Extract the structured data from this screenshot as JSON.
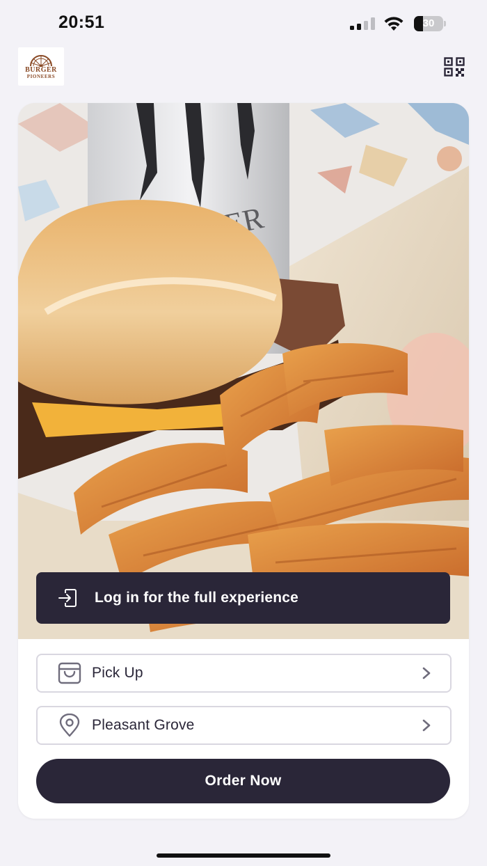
{
  "status_bar": {
    "time": "20:51",
    "battery_level": "30",
    "battery_fraction": 0.3,
    "icons": [
      "signal-icon",
      "wifi-icon",
      "battery-icon"
    ]
  },
  "header": {
    "logo": {
      "line1": "BURGER",
      "line2": "PIONEERS",
      "icon": "wagon-wheel-logo"
    },
    "qr_icon": "qr-code-icon"
  },
  "hero": {
    "image_description_icon": "burger-photo",
    "login_banner": {
      "label": "Log in for the full experience",
      "icon": "login-icon"
    }
  },
  "options": [
    {
      "label": "Pick Up",
      "icon": "shopping-bag-icon",
      "chevron": "chevron-right-icon"
    },
    {
      "label": "Pleasant Grove",
      "icon": "location-pin-icon",
      "chevron": "chevron-right-icon"
    }
  ],
  "order_button": {
    "label": "Order Now"
  },
  "colors": {
    "background": "#f3f2f7",
    "primary_dark": "#2a2638",
    "card": "#ffffff",
    "row_border": "#d9d7e0",
    "icon_gray": "#6f6c7c",
    "logo_brown": "#8a4a26"
  }
}
